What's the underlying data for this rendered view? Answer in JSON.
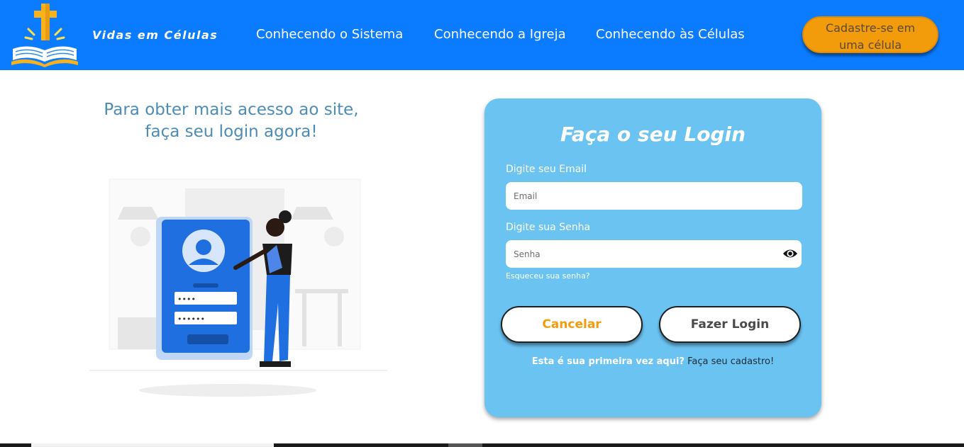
{
  "header": {
    "brand": "Vidas em Células",
    "nav": [
      {
        "label": "Conhecendo o Sistema"
      },
      {
        "label": "Conhecendo a Igreja"
      },
      {
        "label": "Conhecendo às Células"
      }
    ],
    "cta_line1": "Cadastre-se em",
    "cta_line2": "uma célula"
  },
  "promo": {
    "line1": "Para obter mais acesso ao site,",
    "line2": "faça seu login agora!",
    "illustration_password_dots_1": "••••",
    "illustration_password_dots_2": "••••••"
  },
  "login": {
    "title": "Faça o seu Login",
    "email_label": "Digite seu Email",
    "email_placeholder": "Email",
    "email_value": "",
    "password_label": "Digite sua Senha",
    "password_placeholder": "Senha",
    "password_value": "",
    "forgot": "Esqueceu sua senha?",
    "cancel": "Cancelar",
    "submit": "Fazer Login",
    "first_time": "Esta é sua primeira vez aqui?",
    "signup_link": "Faça seu cadastro!"
  },
  "colors": {
    "header_bg": "#0b7cff",
    "cta_bg": "#f39c0b",
    "card_bg": "#6bc3f2",
    "promo_text": "#4c8cb5"
  },
  "icons": [
    "cross-bible-logo-icon",
    "eye-icon"
  ]
}
